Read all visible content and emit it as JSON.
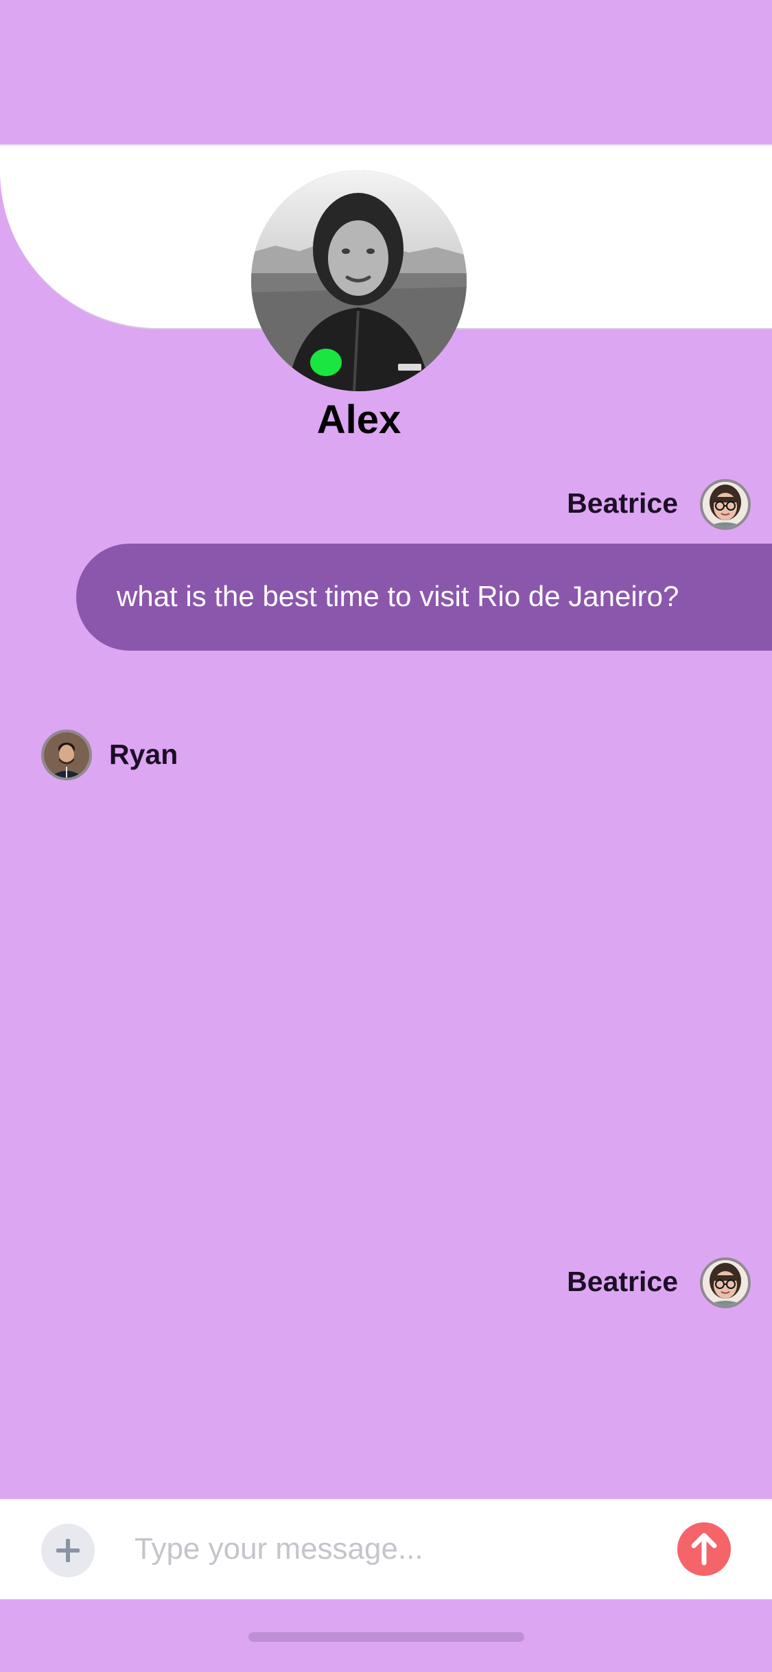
{
  "contact": {
    "name": "Alex",
    "status": "online",
    "status_color": "#19e640"
  },
  "messages": [
    {
      "sender": "Beatrice",
      "direction": "outgoing",
      "text": "what is the best time to visit Rio de Janeiro?"
    },
    {
      "sender": "Ryan",
      "direction": "incoming",
      "text": ""
    },
    {
      "sender": "Beatrice",
      "direction": "outgoing",
      "text": ""
    }
  ],
  "composer": {
    "placeholder": "Type your message...",
    "add_icon": "plus-icon",
    "send_icon": "arrow-up-icon"
  },
  "colors": {
    "background": "#dda6f2",
    "bubble": "#8b57ad",
    "send_button": "#f56468"
  }
}
